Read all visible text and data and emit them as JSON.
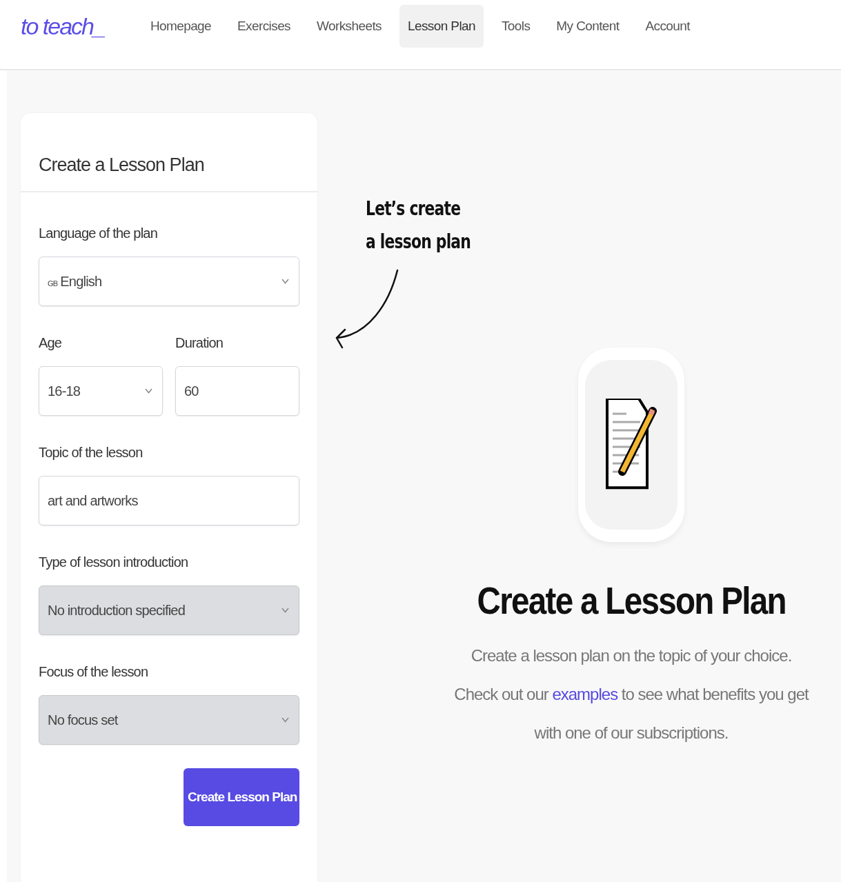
{
  "logo": "to teach_",
  "nav": [
    {
      "label": "Homepage",
      "selected": false
    },
    {
      "label": "Exercises",
      "selected": false
    },
    {
      "label": "Worksheets",
      "selected": false
    },
    {
      "label": "Lesson Plan",
      "selected": true
    },
    {
      "label": "Tools",
      "selected": false
    },
    {
      "label": "My Content",
      "selected": false
    },
    {
      "label": "Account",
      "selected": false
    }
  ],
  "form": {
    "title": "Create a Lesson Plan",
    "fields": [
      {
        "kind": "select",
        "label": "Language of the plan",
        "flag": "GB",
        "value": "English",
        "disabled": false
      },
      {
        "kind": "pair",
        "items": [
          {
            "kind": "select",
            "label": "Age",
            "value": "16-18",
            "disabled": false
          },
          {
            "kind": "input",
            "label": "Duration",
            "value": "60",
            "disabled": false
          }
        ]
      },
      {
        "kind": "input",
        "label": "Topic of the lesson",
        "value": "art and artworks",
        "disabled": false
      },
      {
        "kind": "select",
        "label": "Type of lesson introduction",
        "value": "No introduction specified",
        "disabled": true
      },
      {
        "kind": "select",
        "label": "Focus of the lesson",
        "value": "No focus set",
        "disabled": true
      }
    ],
    "submit": "Create Lesson Plan"
  },
  "callout": [
    "Let’s create",
    "a lesson plan"
  ],
  "hero": {
    "title": "Create a Lesson Plan",
    "text_before": "Create a lesson plan on the topic of your choice. Check out our",
    "link": "examples",
    "text_after": "to see what benefits you get with one of our subscriptions."
  }
}
